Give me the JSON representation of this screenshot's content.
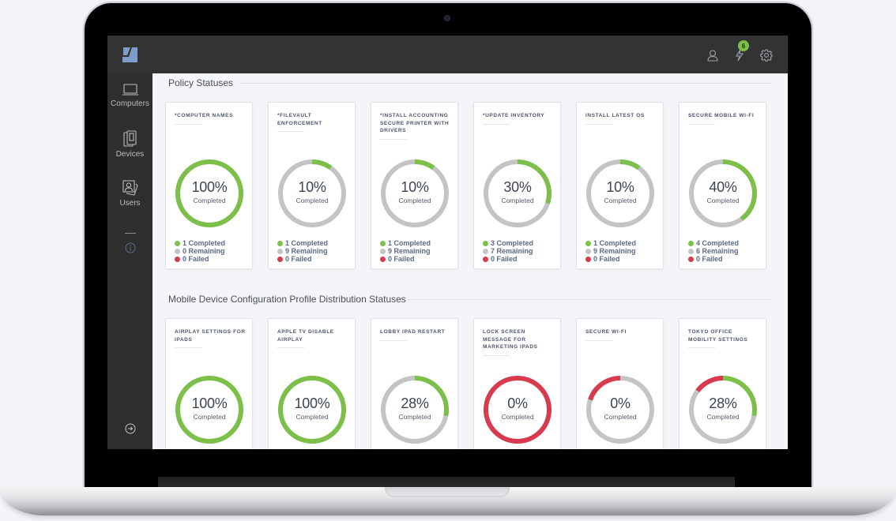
{
  "colors": {
    "completed": "#7cc04a",
    "remaining": "#c4c4c4",
    "failed": "#d83a4e",
    "badge": "#7cc04a",
    "logo": "#7d9cc9"
  },
  "header": {
    "notification_count": "6",
    "icons": [
      "user-icon",
      "lightning-icon",
      "gear-icon"
    ]
  },
  "sidebar": {
    "items": [
      {
        "label": "Computers",
        "icon": "laptop-icon"
      },
      {
        "label": "Devices",
        "icon": "devices-icon"
      },
      {
        "label": "Users",
        "icon": "users-icon"
      }
    ],
    "info_icon": "info-icon",
    "logout_icon": "logout-icon"
  },
  "sections": [
    {
      "title": "Policy Statuses",
      "cards": [
        {
          "title": "*Computer Names",
          "percent": "100%",
          "status": "Completed",
          "completed": 1,
          "remaining": 0,
          "failed": 0,
          "completed_label": "1 Completed",
          "remaining_label": "0 Remaining",
          "failed_label": "0 Failed"
        },
        {
          "title": "*FileVault Enforcement",
          "percent": "10%",
          "status": "Completed",
          "completed": 1,
          "remaining": 9,
          "failed": 0,
          "completed_label": "1 Completed",
          "remaining_label": "9 Remaining",
          "failed_label": "0 Failed"
        },
        {
          "title": "*Install Accounting Secure Printer with Drivers",
          "percent": "10%",
          "status": "Completed",
          "completed": 1,
          "remaining": 9,
          "failed": 0,
          "completed_label": "1 Completed",
          "remaining_label": "9 Remaining",
          "failed_label": "0 Failed"
        },
        {
          "title": "*Update Inventory",
          "percent": "30%",
          "status": "Completed",
          "completed": 3,
          "remaining": 7,
          "failed": 0,
          "completed_label": "3 Completed",
          "remaining_label": "7 Remaining",
          "failed_label": "0 Failed"
        },
        {
          "title": "Install Latest OS",
          "percent": "10%",
          "status": "Completed",
          "completed": 1,
          "remaining": 9,
          "failed": 0,
          "completed_label": "1 Completed",
          "remaining_label": "9 Remaining",
          "failed_label": "0 Failed"
        },
        {
          "title": "Secure Mobile Wi-Fi",
          "percent": "40%",
          "status": "Completed",
          "completed": 4,
          "remaining": 6,
          "failed": 0,
          "completed_label": "4 Completed",
          "remaining_label": "6 Remaining",
          "failed_label": "0 Failed"
        }
      ]
    },
    {
      "title": "Mobile Device Configuration Profile Distribution Statuses",
      "cards": [
        {
          "title": "AirPlay Settings for iPads",
          "percent": "100%",
          "status": "Completed",
          "ring": {
            "completed": 1.0,
            "failed": 0
          }
        },
        {
          "title": "Apple TV Disable AirPlay",
          "percent": "100%",
          "status": "Completed",
          "ring": {
            "completed": 1.0,
            "failed": 0
          }
        },
        {
          "title": "Lobby iPad Restart",
          "percent": "28%",
          "status": "Completed",
          "ring": {
            "completed": 0.28,
            "failed": 0
          }
        },
        {
          "title": "Lock Screen Message for Marketing iPads",
          "percent": "0%",
          "status": "Completed",
          "ring": {
            "completed": 0,
            "failed": 1.0
          }
        },
        {
          "title": "Secure Wi-Fi",
          "percent": "0%",
          "status": "Completed",
          "ring": {
            "completed": 0,
            "failed": 0.2
          }
        },
        {
          "title": "Tokyo Office Mobility Settings",
          "percent": "28%",
          "status": "Completed",
          "ring": {
            "completed": 0.28,
            "failed": 0.15
          }
        }
      ]
    }
  ]
}
